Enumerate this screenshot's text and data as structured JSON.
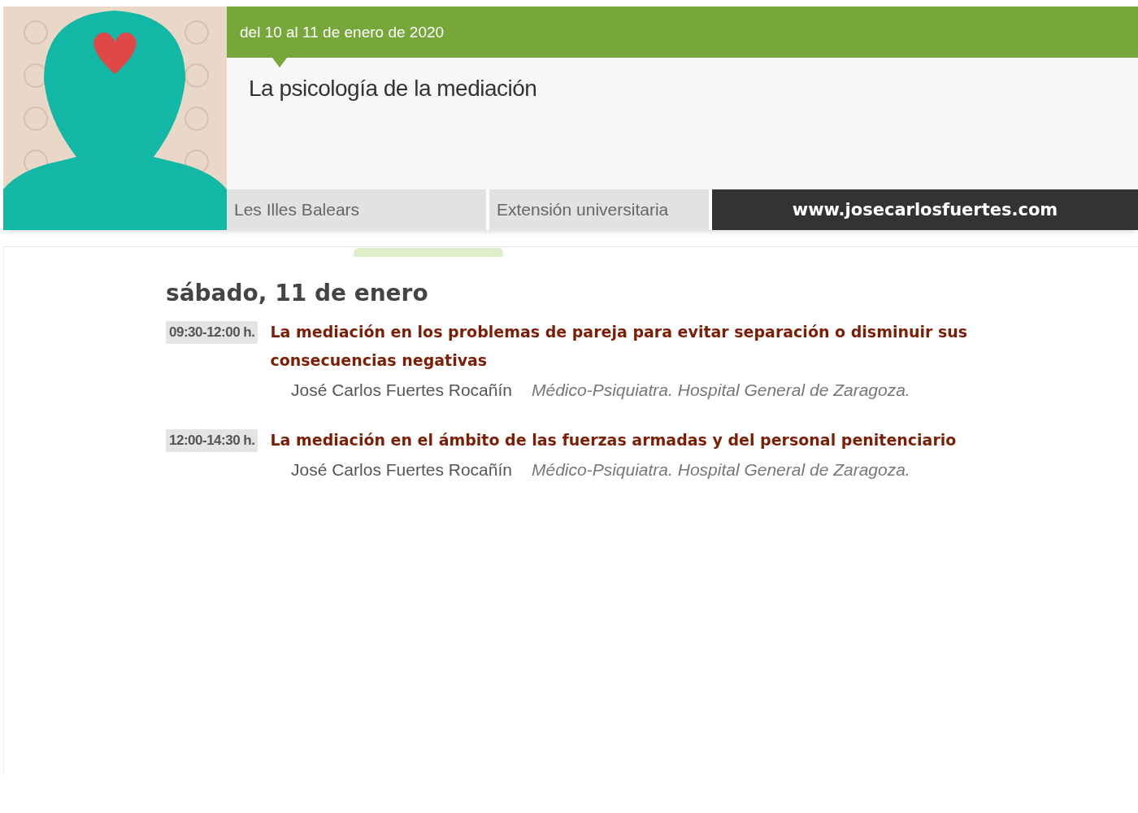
{
  "event": {
    "dates": "del 10 al 11 de enero de 2020",
    "title": "La psicología de la mediación"
  },
  "tabs": [
    {
      "label": "Les Illes Balears"
    },
    {
      "label": "Extensión universitaria"
    }
  ],
  "website_banner": "www.josecarlosfuertes.com",
  "day": {
    "heading": "sábado, 11 de enero",
    "sessions": [
      {
        "time": "09:30-12:00 h.",
        "title": "La mediación en los problemas de pareja para evitar separación o disminuir sus consecuencias negativas",
        "speakers": [
          {
            "name": "José Carlos Fuertes Rocañín",
            "affiliation": "Médico-Psiquiatra. Hospital General de Zaragoza."
          }
        ]
      },
      {
        "time": "12:00-14:30 h.",
        "title": "La mediación en el ámbito de las fuerzas armadas y del personal penitenciario",
        "speakers": [
          {
            "name": "José Carlos Fuertes Rocañín",
            "affiliation": "Médico-Psiquiatra. Hospital General de Zaragoza."
          }
        ]
      }
    ]
  }
}
